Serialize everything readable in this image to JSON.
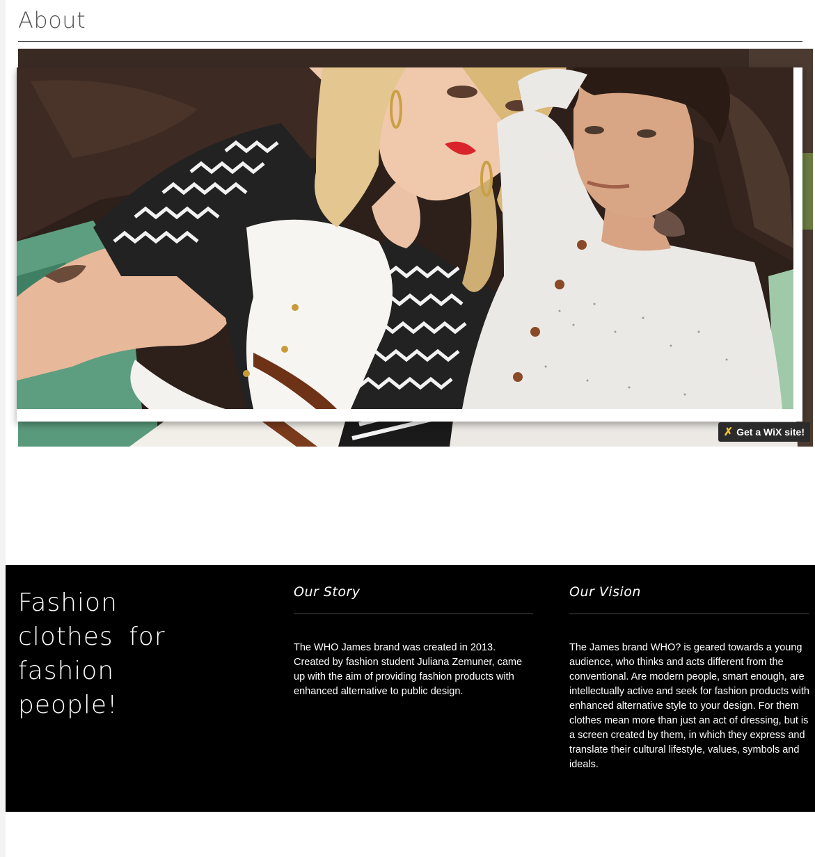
{
  "about": {
    "title": "About"
  },
  "wix_badge": {
    "label": "Get a WiX site!"
  },
  "footer": {
    "tagline": "Fashion clothes for fashion people!",
    "story": {
      "heading": "Our Story",
      "body": "The WHO James brand was created in 2013. Created by fashion student Juliana Zemuner, came up with the aim of providing fashion products with enhanced alternative to public design."
    },
    "vision": {
      "heading": "Our Vision",
      "body": "The James brand WHO? is geared towards a young audience, who thinks and acts different from the conventional. Are modern people, smart enough, are intellectually active and seek for fashion products with enhanced alternative style to your design. For them clothes mean more than just an act of dressing, but is a screen created by them, in which they express and translate their cultural lifestyle, values, symbols and ideals."
    }
  },
  "colors": {
    "footer_bg": "#000000",
    "badge_bg": "#2b2b2b",
    "badge_icon": "#f3c12a"
  }
}
